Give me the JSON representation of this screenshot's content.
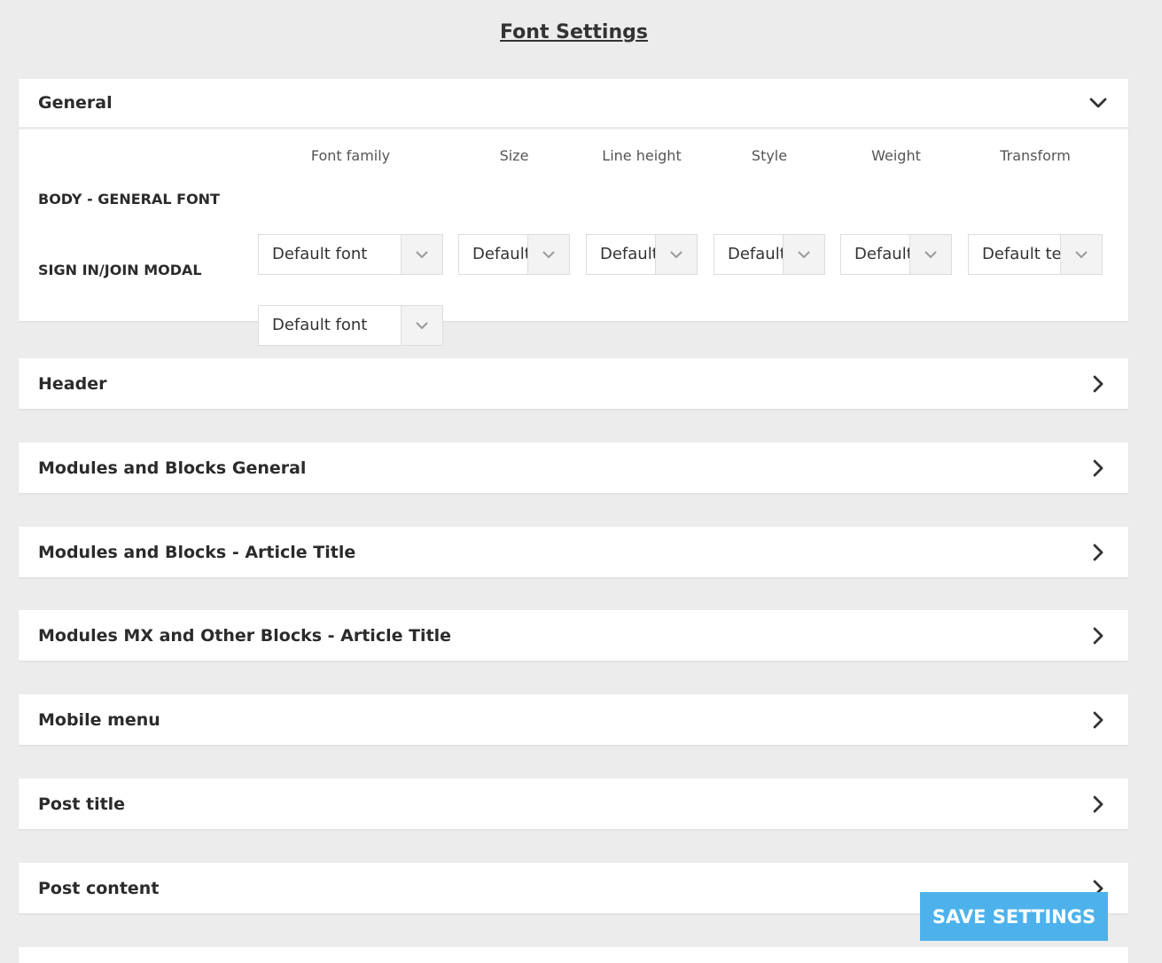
{
  "page": {
    "title": "Font Settings"
  },
  "general": {
    "title": "General",
    "columns": [
      "Font family",
      "Size",
      "Line height",
      "Style",
      "Weight",
      "Transform"
    ],
    "rows": [
      {
        "label": "BODY - GENERAL FONT",
        "values": [
          "Default font",
          "Default",
          "Default",
          "Default",
          "Default",
          "Default text"
        ]
      },
      {
        "label": "SIGN IN/JOIN MODAL",
        "values": [
          "Default font"
        ]
      }
    ]
  },
  "sections": [
    {
      "title": "Header"
    },
    {
      "title": "Modules and Blocks General"
    },
    {
      "title": "Modules and Blocks - Article Title"
    },
    {
      "title": "Modules MX and Other Blocks - Article Title"
    },
    {
      "title": "Mobile menu"
    },
    {
      "title": "Post title"
    },
    {
      "title": "Post content"
    }
  ],
  "save_button": {
    "label": "SAVE SETTINGS"
  },
  "colors": {
    "accent": "#4db2ec",
    "background": "#ececec"
  },
  "icons": {
    "expanded": "chevron-down-icon",
    "collapsed": "chevron-right-icon",
    "select": "chevron-down-icon"
  }
}
